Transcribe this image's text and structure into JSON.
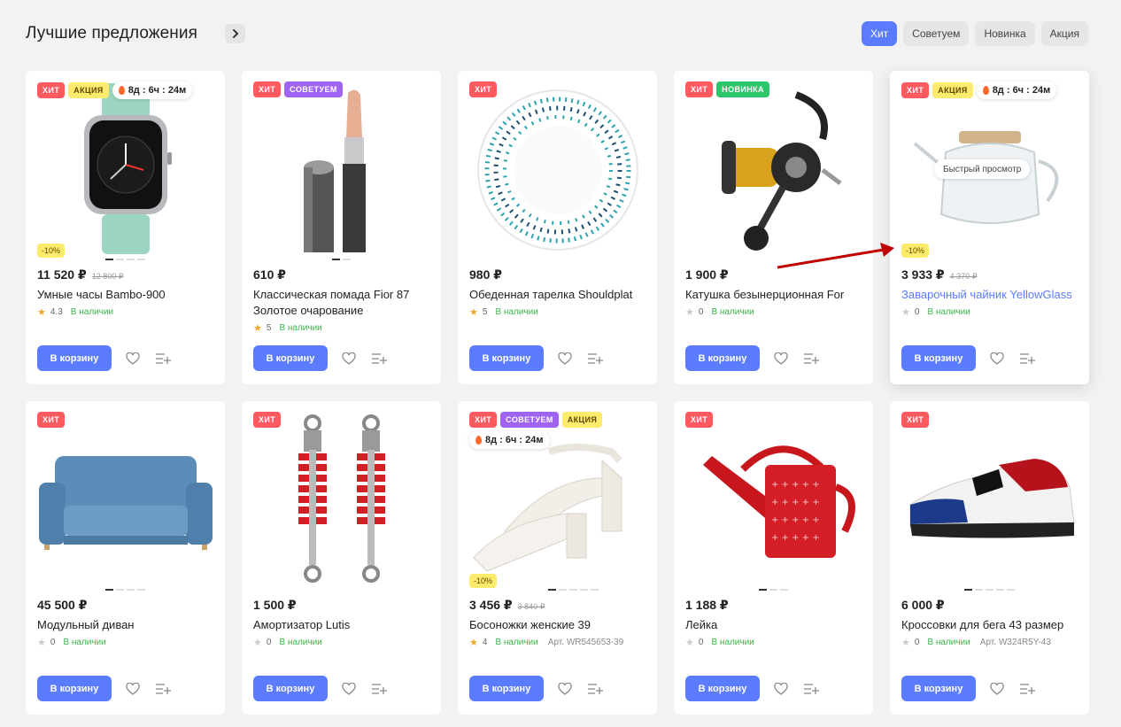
{
  "section": {
    "title": "Лучшие предложения",
    "tabs": [
      "Хит",
      "Советуем",
      "Новинка",
      "Акция"
    ]
  },
  "labels": {
    "hit": "ХИТ",
    "sale": "АКЦИЯ",
    "rec": "СОВЕТУЕМ",
    "new": "НОВИНКА",
    "timer": "8д : 6ч : 24м",
    "discount": "-10%",
    "in_stock": "В наличии",
    "cart": "В корзину",
    "quick_view": "Быстрый просмотр"
  },
  "products": [
    {
      "name": "Умные часы Bambo-900",
      "price": "11 520 ₽",
      "old_price": "12 800 ₽",
      "rating": "4.3"
    },
    {
      "name": "Классическая помада Fior 87 Золотое очарование",
      "price": "610 ₽",
      "old_price": "",
      "rating": "5"
    },
    {
      "name": "Обеденная тарелка Shouldplat",
      "price": "980 ₽",
      "old_price": "",
      "rating": "5"
    },
    {
      "name": "Катушка безынерционная For",
      "price": "1 900 ₽",
      "old_price": "",
      "rating": "0"
    },
    {
      "name": "Заварочный чайник YellowGlass",
      "price": "3 933 ₽",
      "old_price": "4 370 ₽",
      "rating": "0"
    },
    {
      "name": "Модульный диван",
      "price": "45 500 ₽",
      "old_price": "",
      "rating": "0"
    },
    {
      "name": "Амортизатор Lutis",
      "price": "1 500 ₽",
      "old_price": "",
      "rating": "0"
    },
    {
      "name": "Босоножки женские 39",
      "price": "3 456 ₽",
      "old_price": "3 840 ₽",
      "rating": "4",
      "article": "Арт. WR545653-39"
    },
    {
      "name": "Лейка",
      "price": "1 188 ₽",
      "old_price": "",
      "rating": "0"
    },
    {
      "name": "Кроссовки для бега 43 размер",
      "price": "6 000 ₽",
      "old_price": "",
      "rating": "0",
      "article": "Арт. W324R5Y-43"
    }
  ],
  "colors": {
    "accent": "#5b7cff",
    "hit": "#ff5a5f",
    "sale": "#ffeb6b",
    "rec": "#a064f5",
    "new": "#2ec66a",
    "in_stock": "#3bb54a",
    "annotation_arrow": "#c00000"
  }
}
